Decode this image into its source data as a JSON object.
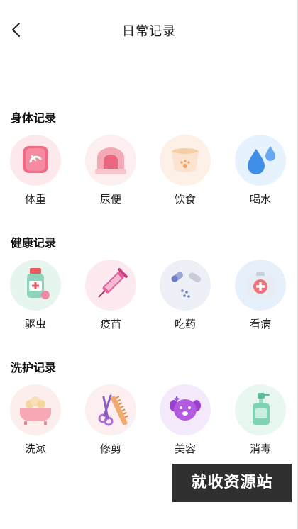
{
  "header": {
    "title": "日常记录",
    "back_icon": "chevron-left-icon"
  },
  "sections": [
    {
      "title": "身体记录",
      "items": [
        {
          "label": "体重",
          "icon": "scale-icon"
        },
        {
          "label": "尿便",
          "icon": "litter-box-icon"
        },
        {
          "label": "饮食",
          "icon": "food-bowl-icon"
        },
        {
          "label": "喝水",
          "icon": "water-drops-icon"
        }
      ]
    },
    {
      "title": "健康记录",
      "items": [
        {
          "label": "驱虫",
          "icon": "medicine-bottle-icon"
        },
        {
          "label": "疫苗",
          "icon": "syringe-icon"
        },
        {
          "label": "吃药",
          "icon": "pills-icon"
        },
        {
          "label": "看病",
          "icon": "first-aid-kit-icon"
        }
      ]
    },
    {
      "title": "洗护记录",
      "items": [
        {
          "label": "洗漱",
          "icon": "bathtub-icon"
        },
        {
          "label": "修剪",
          "icon": "scissors-comb-icon"
        },
        {
          "label": "美容",
          "icon": "grooming-dog-icon"
        },
        {
          "label": "消毒",
          "icon": "disinfectant-bottle-icon"
        }
      ]
    }
  ],
  "watermark": "就收资源站"
}
